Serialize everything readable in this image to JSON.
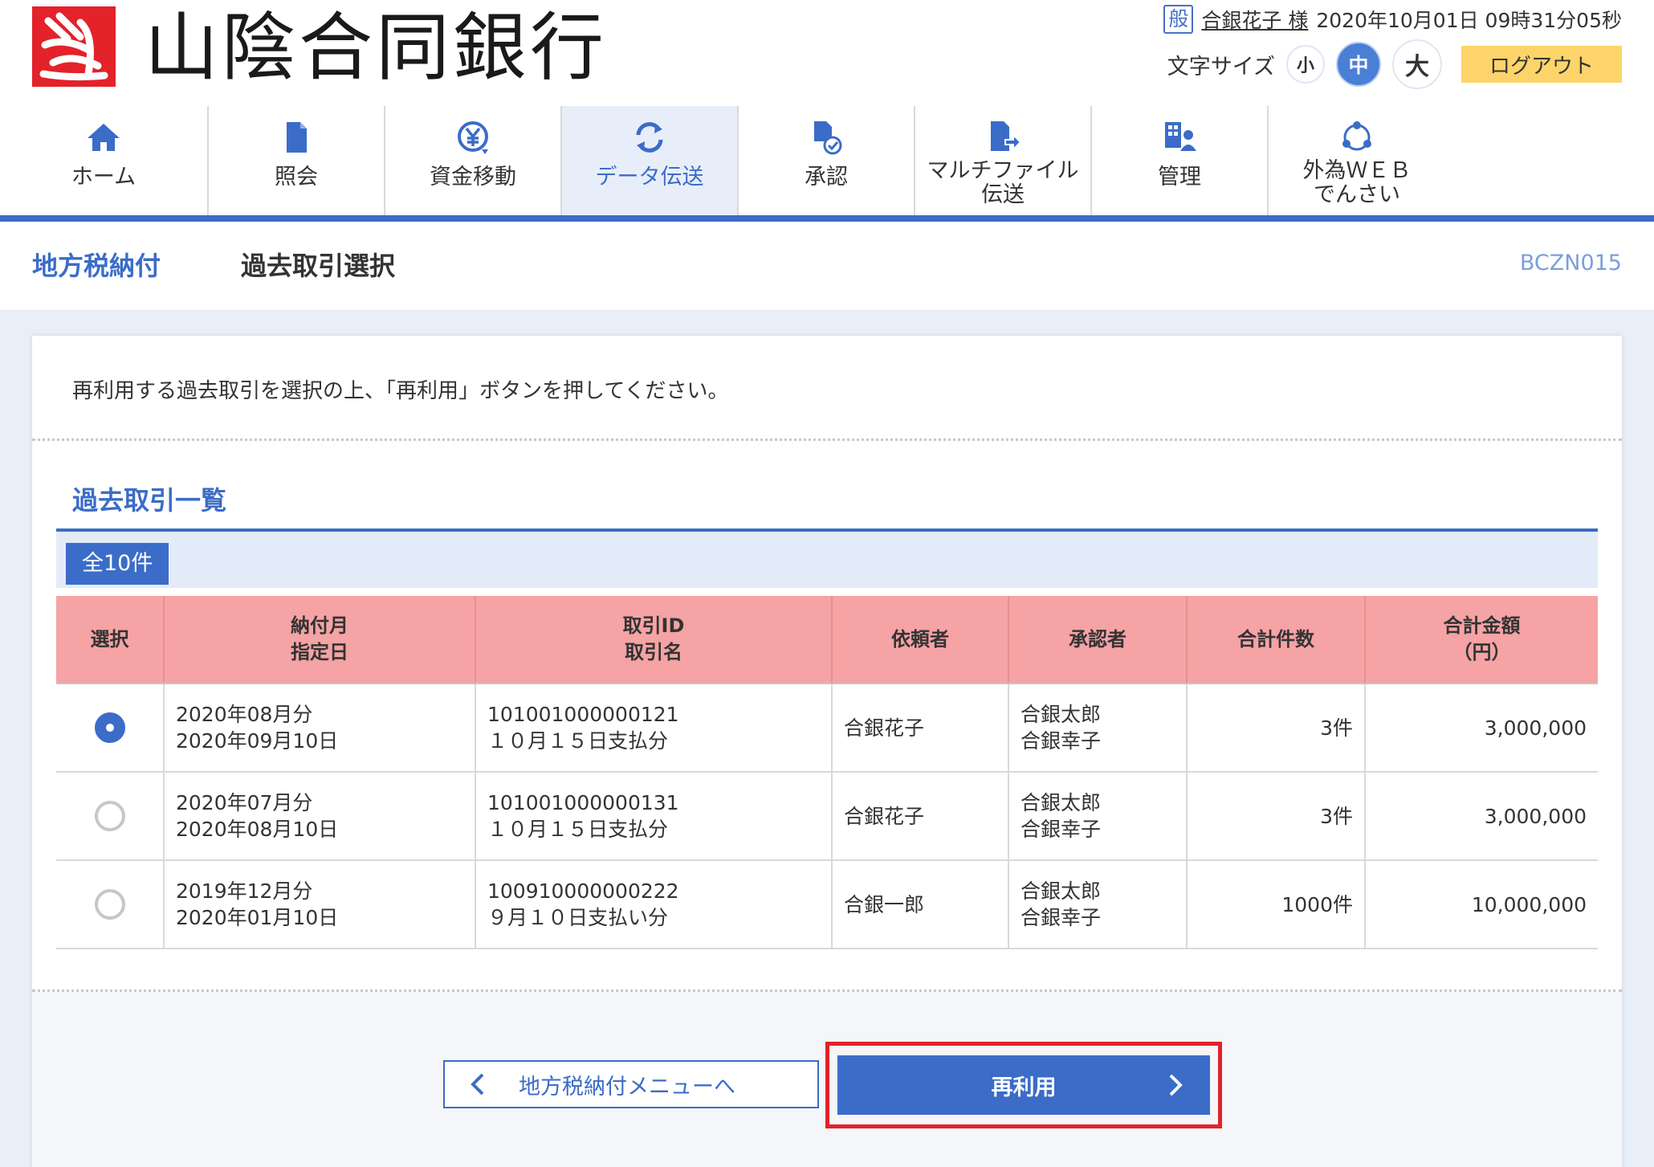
{
  "header": {
    "bank_name": "山陰合同銀行",
    "user_badge": "般",
    "user_name": "合銀花子 様",
    "datetime": "2020年10月01日 09時31分05秒",
    "font_size_label": "文字サイズ",
    "font_sizes": {
      "small": "小",
      "medium": "中",
      "large": "大"
    },
    "logout_label": "ログアウト"
  },
  "nav": [
    {
      "label": "ホーム",
      "icon": "home-icon"
    },
    {
      "label": "照会",
      "icon": "document-icon"
    },
    {
      "label": "資金移動",
      "icon": "yen-transfer-icon"
    },
    {
      "label": "データ伝送",
      "icon": "sync-icon",
      "active": true
    },
    {
      "label": "承認",
      "icon": "approval-document-icon"
    },
    {
      "label": "マルチファイル\n伝送",
      "icon": "file-transfer-icon"
    },
    {
      "label": "管理",
      "icon": "management-icon"
    },
    {
      "label": "外為ＷＥＢ\nでんさい",
      "icon": "network-circle-icon"
    }
  ],
  "page": {
    "title": "地方税納付",
    "subtitle": "過去取引選択",
    "screen_id": "BCZN015",
    "instruction": "再利用する過去取引を選択の上、「再利用」ボタンを押してください。",
    "section_title": "過去取引一覧",
    "total_count": "全10件"
  },
  "table": {
    "headers": [
      "選択",
      "納付月\n指定日",
      "取引ID\n取引名",
      "依頼者",
      "承認者",
      "合計件数",
      "合計金額\n（円）"
    ],
    "rows": [
      {
        "selected": true,
        "month_date": "2020年08月分\n2020年09月10日",
        "tx": "101001000000121\n１０月１５日支払分",
        "requester": "合銀花子",
        "approvers": "合銀太郎\n合銀幸子",
        "count": "3件",
        "amount": "3,000,000"
      },
      {
        "selected": false,
        "month_date": "2020年07月分\n2020年08月10日",
        "tx": "101001000000131\n１０月１５日支払分",
        "requester": "合銀花子",
        "approvers": "合銀太郎\n合銀幸子",
        "count": "3件",
        "amount": "3,000,000"
      },
      {
        "selected": false,
        "month_date": "2019年12月分\n2020年01月10日",
        "tx": "100910000000222\n９月１０日支払い分",
        "requester": "合銀一郎",
        "approvers": "合銀太郎\n合銀幸子",
        "count": "1000件",
        "amount": "10,000,000"
      }
    ]
  },
  "buttons": {
    "back_label": "地方税納付メニューへ",
    "reuse_label": "再利用"
  },
  "colors": {
    "primary": "#3b6cc8",
    "table_header": "#f5a3a5",
    "logout": "#fcd46a",
    "highlight_frame": "#e3222a",
    "logo_red": "#e3222a"
  }
}
